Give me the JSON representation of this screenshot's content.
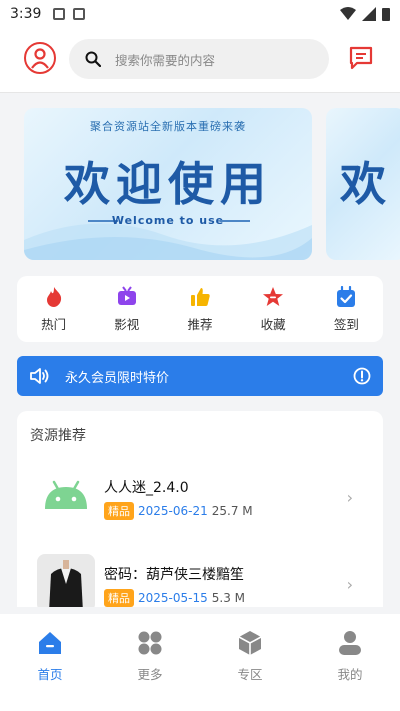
{
  "status_bar": {
    "time": "3:39"
  },
  "header": {
    "avatar_icon": "user-icon",
    "search_placeholder": "搜索你需要的内容",
    "message_icon": "message-icon"
  },
  "banners": [
    {
      "subtitle": "聚合资源站全新版本重磅来袭",
      "title": "欢迎使用",
      "english": "Welcome to use"
    },
    {
      "title": "欢"
    }
  ],
  "quick_menu": [
    {
      "label": "热门",
      "icon": "fire-icon",
      "color": "#e53935"
    },
    {
      "label": "影视",
      "icon": "tv-icon",
      "color": "#8e44ec"
    },
    {
      "label": "推荐",
      "icon": "thumbs-up-icon",
      "color": "#f6b400"
    },
    {
      "label": "收藏",
      "icon": "star-icon",
      "color": "#e53935"
    },
    {
      "label": "签到",
      "icon": "calendar-check-icon",
      "color": "#2b7de9"
    }
  ],
  "notice": {
    "text": "永久会员限时特价",
    "icon": "speaker-icon",
    "info_icon": "info-icon"
  },
  "section": {
    "title": "资源推荐",
    "items": [
      {
        "title": "人人迷_2.4.0",
        "tag": "精品",
        "date": "2025-06-21",
        "size": "25.7 M",
        "thumb": "android-icon"
      },
      {
        "title": "密码：葫芦侠三楼黯笙",
        "tag": "精品",
        "date": "2025-05-15",
        "size": "5.3 M",
        "thumb": "suit-thumbnail"
      }
    ]
  },
  "tabs": [
    {
      "label": "首页",
      "icon": "home-icon",
      "active": true
    },
    {
      "label": "更多",
      "icon": "grid-icon",
      "active": false
    },
    {
      "label": "专区",
      "icon": "cube-icon",
      "active": false
    },
    {
      "label": "我的",
      "icon": "person-icon",
      "active": false
    }
  ],
  "colors": {
    "accent": "#2b7de9",
    "tag": "#ffa41b",
    "avatar": "#e53935"
  }
}
